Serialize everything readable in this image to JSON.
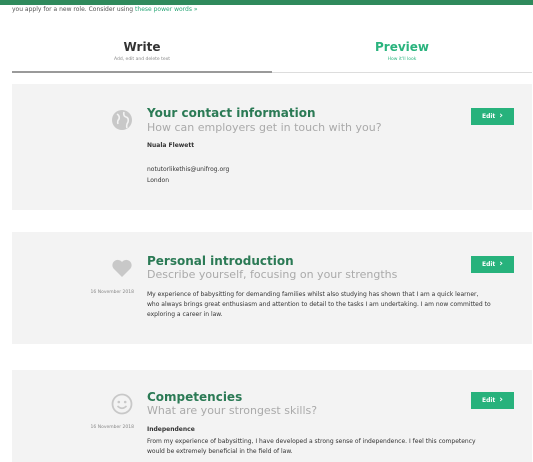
{
  "intro": {
    "text": "you apply for a new role. Consider using",
    "link": "these power words »"
  },
  "tabs": [
    {
      "label": "Write",
      "sublabel": "Add, edit and delete text"
    },
    {
      "label": "Preview",
      "sublabel": "How it'll look"
    }
  ],
  "edit_label": "Edit",
  "sections": {
    "contact": {
      "title": "Your contact information",
      "subtitle": "How can employers get in touch with you?",
      "name": "Nuala Flewett",
      "email": "notutorlikethis@unifrog.org",
      "location": "London"
    },
    "intro": {
      "title": "Personal introduction",
      "subtitle": "Describe yourself, focusing on your strengths",
      "date": "16 November 2018",
      "body": "My experience of babysitting for demanding families whilst also studying has shown that I am a quick learner, who always brings great enthusiasm and attention to detail to the tasks I am undertaking. I am now committed to exploring a career in law."
    },
    "competencies": {
      "title": "Competencies",
      "subtitle": "What are your strongest skills?",
      "date": "16 November 2018",
      "item_title": "Independence",
      "body": "From my experience of babysitting, I have developed a strong sense of independence. I feel this competency would be extremely beneficial in the field of law."
    }
  },
  "colors": {
    "brand_green": "#27b27c",
    "heading_green": "#2b7a55",
    "card_bg": "#f3f3f3"
  }
}
